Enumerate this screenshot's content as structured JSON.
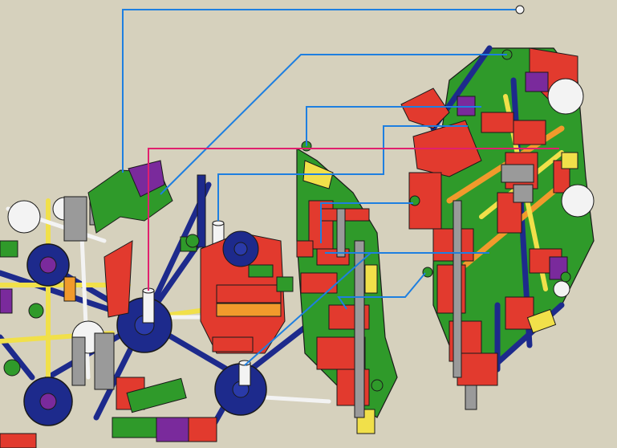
{
  "scene": {
    "background": "#d6d1bd",
    "palette": {
      "red": "#e23a2e",
      "red_dark": "#9c1e16",
      "green": "#2f9a2a",
      "green_dark": "#1c5e18",
      "blue": "#1d2a8c",
      "purple": "#7a2a9c",
      "yellow": "#f1e04a",
      "orange": "#f19a2c",
      "gray": "#9a9a9a",
      "white": "#f3f3f3",
      "outline": "#1a1a1a"
    },
    "connector_colors": {
      "blue_leaders": "#1e7fe0",
      "magenta_leader": "#e0206e"
    },
    "leader_counts": {
      "blue": 8,
      "magenta": 1
    }
  }
}
